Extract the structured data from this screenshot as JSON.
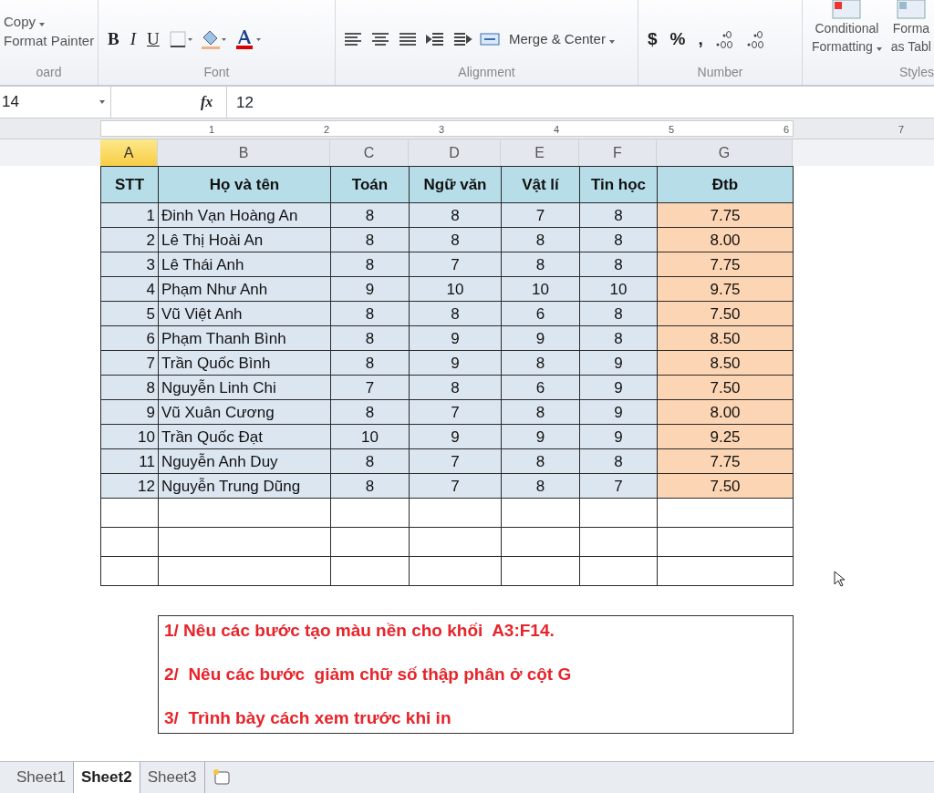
{
  "ribbon": {
    "clipboard": {
      "items": [
        "Copy",
        "Format Painter"
      ],
      "label": "oard"
    },
    "font": {
      "buttons": [
        "B",
        "I",
        "U"
      ],
      "label": "Font"
    },
    "alignment": {
      "merge": "Merge & Center",
      "label": "Alignment"
    },
    "number": {
      "buttons": [
        "$",
        "%",
        ","
      ],
      "label": "Number"
    },
    "styles": {
      "items": [
        {
          "line1": "Conditional",
          "line2": "Formatting"
        },
        {
          "line1": "Forma",
          "line2": "as Tabl"
        }
      ],
      "label": "Styles"
    }
  },
  "formula_bar": {
    "name_box": "14",
    "fx": "fx",
    "value": "12"
  },
  "ruler": [
    "1",
    "2",
    "3",
    "4",
    "5",
    "6",
    "7"
  ],
  "columns": [
    {
      "label": "A",
      "selected": true
    },
    {
      "label": "B",
      "selected": false
    },
    {
      "label": "C",
      "selected": false
    },
    {
      "label": "D",
      "selected": false
    },
    {
      "label": "E",
      "selected": false
    },
    {
      "label": "F",
      "selected": false
    },
    {
      "label": "G",
      "selected": false
    }
  ],
  "table": {
    "headers": [
      "STT",
      "Họ và tên",
      "Toán",
      "Ngữ văn",
      "Vật lí",
      "Tin học",
      "Đtb"
    ],
    "rows": [
      [
        "1",
        "Đinh Vạn Hoàng An",
        "8",
        "8",
        "7",
        "8",
        "7.75"
      ],
      [
        "2",
        "Lê Thị Hoài An",
        "8",
        "8",
        "8",
        "8",
        "8.00"
      ],
      [
        "3",
        "Lê Thái Anh",
        "8",
        "7",
        "8",
        "8",
        "7.75"
      ],
      [
        "4",
        "Phạm Như Anh",
        "9",
        "10",
        "10",
        "10",
        "9.75"
      ],
      [
        "5",
        "Vũ Việt Anh",
        "8",
        "8",
        "6",
        "8",
        "7.50"
      ],
      [
        "6",
        "Phạm Thanh Bình",
        "8",
        "9",
        "9",
        "8",
        "8.50"
      ],
      [
        "7",
        "Trần Quốc Bình",
        "8",
        "9",
        "8",
        "9",
        "8.50"
      ],
      [
        "8",
        "Nguyễn Linh Chi",
        "7",
        "8",
        "6",
        "9",
        "7.50"
      ],
      [
        "9",
        "Vũ Xuân Cương",
        "8",
        "7",
        "8",
        "9",
        "8.00"
      ],
      [
        "10",
        "Trần Quốc Đạt",
        "10",
        "9",
        "9",
        "9",
        "9.25"
      ],
      [
        "11",
        "Nguyễn Anh Duy",
        "8",
        "7",
        "8",
        "8",
        "7.75"
      ],
      [
        "12",
        "Nguyễn Trung Dũng",
        "8",
        "7",
        "8",
        "7",
        "7.50"
      ]
    ]
  },
  "questions": [
    "1/ Nêu các bước tạo màu nền cho khối  A3:F14.",
    "2/  Nêu các bước  giảm chữ số thập phân ở cột G",
    "3/  Trình bày cách xem trước khi in"
  ],
  "sheet_tabs": [
    {
      "label": "Sheet1",
      "selected": false
    },
    {
      "label": "Sheet2",
      "selected": true
    },
    {
      "label": "Sheet3",
      "selected": false
    }
  ]
}
